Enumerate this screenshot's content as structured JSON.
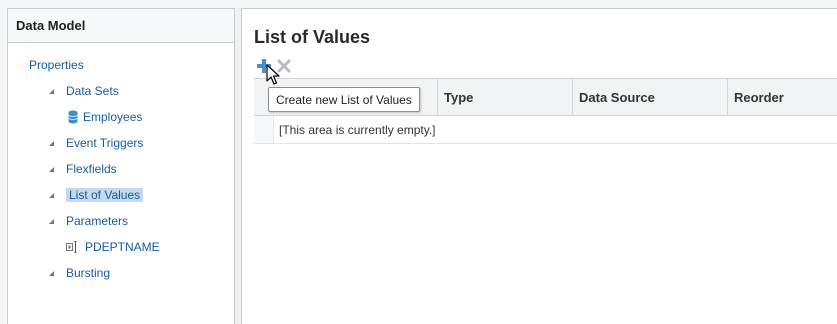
{
  "left_panel": {
    "title": "Data Model",
    "tree": {
      "root_label": "Properties",
      "data_sets_label": "Data Sets",
      "employees_label": "Employees",
      "event_triggers_label": "Event Triggers",
      "flexfields_label": "Flexfields",
      "list_of_values_label": "List of Values",
      "parameters_label": "Parameters",
      "pdeptname_label": "PDEPTNAME",
      "bursting_label": "Bursting",
      "selected_item": "List of Values"
    }
  },
  "main": {
    "title": "List of Values",
    "toolbar": {
      "add_icon": "plus-icon",
      "delete_icon": "close-icon"
    },
    "tooltip": "Create new List of Values",
    "table": {
      "columns": [
        "",
        "Type",
        "Data Source",
        "Reorder"
      ],
      "empty_message": "[This area is currently empty.]"
    }
  },
  "colors": {
    "link": "#145c9e",
    "selected_bg": "#c5d9ec",
    "add_icon": "#4a8fc8",
    "delete_icon": "#b8bcc0"
  }
}
